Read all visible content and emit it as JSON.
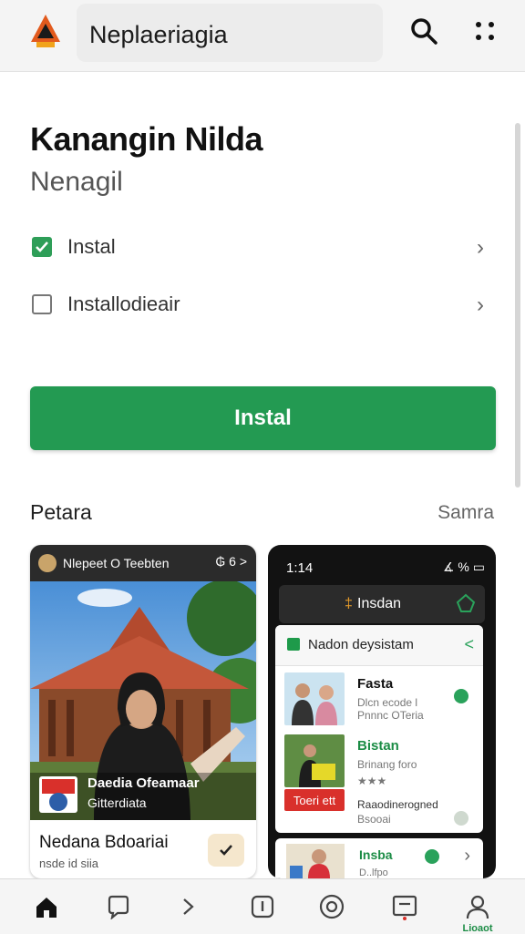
{
  "app_bar": {
    "logo": "app-logo-triangle",
    "search_text": "Neplaeriagia",
    "search_icon": "search-icon",
    "menu_icon": "more-grid-icon"
  },
  "header": {
    "title": "Kanangin Nilda",
    "subtitle": "Nenagil"
  },
  "options": [
    {
      "label": "Instal",
      "checked": true
    },
    {
      "label": "Installodieair",
      "checked": false
    }
  ],
  "install_button": "Instal",
  "section": {
    "title": "Petara",
    "link": "Samra"
  },
  "card_left": {
    "status_title": "Nlepeet O Teebten",
    "status_icons": "₲ 6 >",
    "overlay_line1": "Daedia Ofeamaar",
    "overlay_line2": "Gitterdiata",
    "name": "Nedana Bdoariai",
    "caption": "nsde id siia"
  },
  "card_right": {
    "time": "1:14",
    "status": "∡ % ▭",
    "header_label": "Insdan",
    "panel_title": "Nadon deysistam",
    "apps": [
      {
        "name": "Fasta",
        "desc1": "Dlcn ecode l",
        "desc2": "Pnnnc OTeria"
      },
      {
        "name": "Bistan",
        "desc1": "Brinang foro",
        "desc2": "★★★"
      },
      {
        "name": "Raaodinerogned",
        "desc1": "Bsooai",
        "tag": "Toeri ett"
      }
    ],
    "row4_name": "Insba",
    "row4_desc": "D..lfpo"
  },
  "bottom_nav": {
    "items": [
      "home-icon",
      "chat-icon",
      "chevron-right-icon",
      "info-icon",
      "camera-icon",
      "inbox-icon",
      "profile-icon"
    ],
    "profile_label": "Lioaot"
  },
  "colors": {
    "accent": "#239a52",
    "topbar": "#f4f4f4",
    "dark_card": "#121212"
  }
}
